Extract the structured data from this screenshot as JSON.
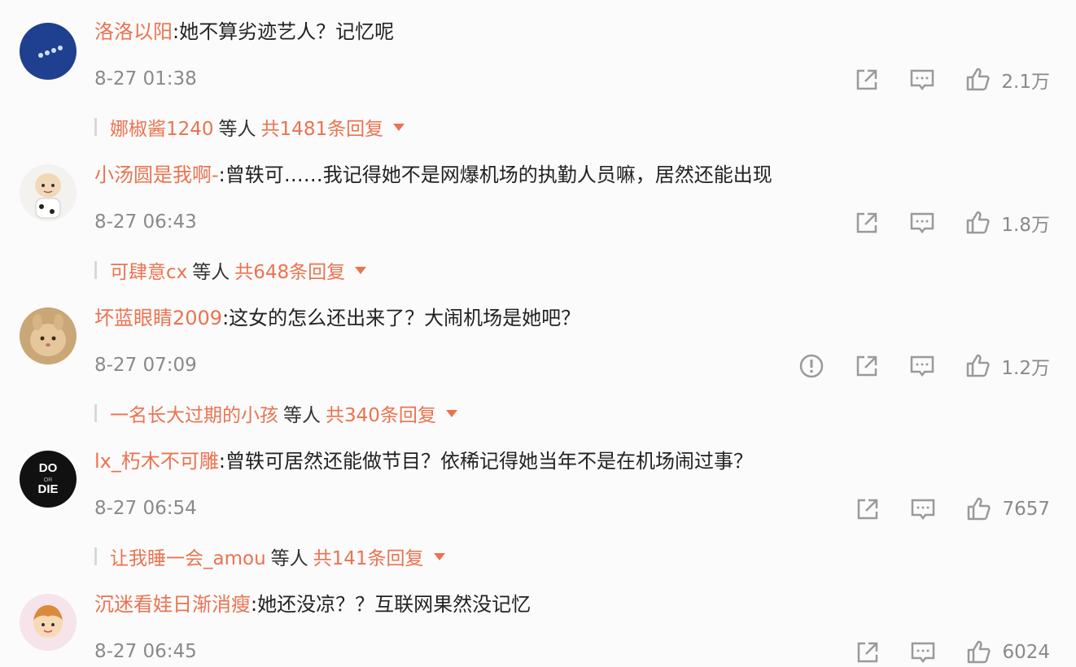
{
  "comments": [
    {
      "username": "洛洛以阳",
      "text": ":她不算劣迹艺人？记忆呢",
      "time": "8-27 01:38",
      "likes": "2.1万",
      "reply_user": "娜椒酱1240",
      "reply_mid": "等人",
      "reply_total": "共1481条回复"
    },
    {
      "username": "小汤圆是我啊-",
      "text": ":曾轶可……我记得她不是网爆机场的执勤人员嘛，居然还能出现",
      "time": "8-27 06:43",
      "likes": "1.8万",
      "reply_user": "可肆意cx",
      "reply_mid": "等人",
      "reply_total": "共648条回复"
    },
    {
      "username": "坏蓝眼睛2009",
      "text": ":这女的怎么还出来了？大闹机场是她吧？",
      "time": "8-27 07:09",
      "likes": "1.2万",
      "reply_user": "一名长大过期的小孩",
      "reply_mid": "等人",
      "reply_total": "共340条回复"
    },
    {
      "username": "lx_朽木不可雕",
      "text": ":曾轶可居然还能做节目？依稀记得她当年不是在机场闹过事？",
      "time": "8-27 06:54",
      "likes": "7657",
      "reply_user": "让我睡一会_amou",
      "reply_mid": "等人",
      "reply_total": "共141条回复"
    },
    {
      "username": "沉迷看娃日渐消瘦",
      "text": ":她还没凉？？互联网果然没记忆",
      "time": "8-27 06:45",
      "likes": "6024"
    }
  ],
  "avatar4_text": [
    "DO",
    "OR",
    "DIE"
  ],
  "colors": {
    "username": "#eb7350",
    "meta": "#8a8a8a",
    "icon": "#9a9a9a"
  },
  "icons": [
    "share-icon",
    "comment-icon",
    "like-icon",
    "report-icon",
    "dropdown-caret-icon"
  ]
}
